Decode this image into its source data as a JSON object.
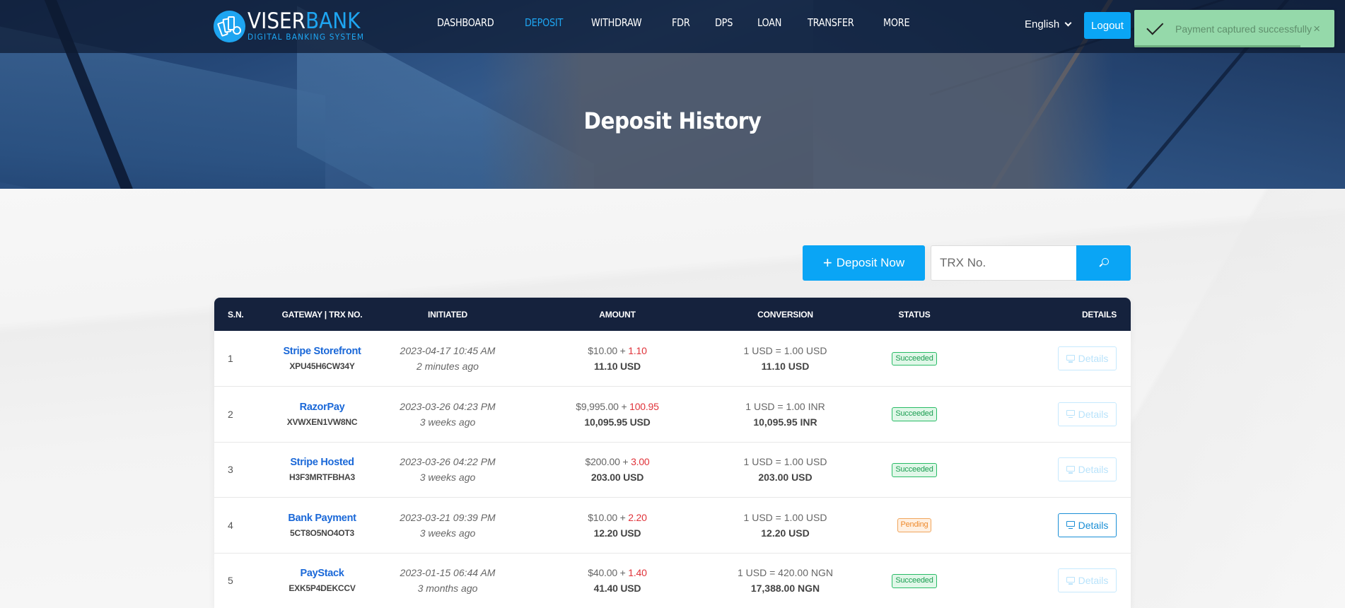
{
  "brand": {
    "name_primary": "VISER",
    "name_accent": "BANK",
    "tagline": "DIGITAL BANKING SYSTEM",
    "accent_color": "#1ea5f1"
  },
  "nav": {
    "items": [
      {
        "label": "DASHBOARD",
        "active": false
      },
      {
        "label": "DEPOSIT",
        "active": true
      },
      {
        "label": "WITHDRAW",
        "active": false
      },
      {
        "label": "FDR",
        "active": false
      },
      {
        "label": "DPS",
        "active": false
      },
      {
        "label": "LOAN",
        "active": false
      },
      {
        "label": "TRANSFER",
        "active": false
      },
      {
        "label": "MORE",
        "active": false
      }
    ],
    "language": "English",
    "logout_label": "Logout"
  },
  "toast": {
    "message": "Payment captured successfully",
    "icon": "check-icon",
    "close_symbol": "×",
    "progress_percent": 83,
    "color": "#95d9aa"
  },
  "hero": {
    "title": "Deposit History"
  },
  "toolbar": {
    "deposit_now_label": "Deposit Now",
    "deposit_now_icon": "+",
    "search_placeholder": "TRX No.",
    "search_value": ""
  },
  "table": {
    "headers": [
      "S.N.",
      "Gateway | TRX No.",
      "Initiated",
      "Amount",
      "Conversion",
      "Status",
      "Details"
    ],
    "rows": [
      {
        "sn": "1",
        "gateway": "Stripe Storefront",
        "trx": "XPU45H6CW34Y",
        "initiated_date": "2023-04-17 10:45 AM",
        "initiated_ago": "2 minutes ago",
        "amount": "$10.00",
        "amount_sep": " + ",
        "charge": "1.10",
        "amount_total": "11.10 USD",
        "conversion_rate": "1 USD = 1.00 USD",
        "conversion_total": "11.10 USD",
        "status": "Succeeded",
        "status_type": "success",
        "details_label": "Details",
        "details_enabled": false
      },
      {
        "sn": "2",
        "gateway": "RazorPay",
        "trx": "XVWXEN1VW8NC",
        "initiated_date": "2023-03-26 04:23 PM",
        "initiated_ago": "3 weeks ago",
        "amount": "$9,995.00",
        "amount_sep": " + ",
        "charge": "100.95",
        "amount_total": "10,095.95 USD",
        "conversion_rate": "1 USD = 1.00 INR",
        "conversion_total": "10,095.95 INR",
        "status": "Succeeded",
        "status_type": "success",
        "details_label": "Details",
        "details_enabled": false
      },
      {
        "sn": "3",
        "gateway": "Stripe Hosted",
        "trx": "H3F3MRTFBHA3",
        "initiated_date": "2023-03-26 04:22 PM",
        "initiated_ago": "3 weeks ago",
        "amount": "$200.00",
        "amount_sep": " + ",
        "charge": "3.00",
        "amount_total": "203.00 USD",
        "conversion_rate": "1 USD = 1.00 USD",
        "conversion_total": "203.00 USD",
        "status": "Succeeded",
        "status_type": "success",
        "details_label": "Details",
        "details_enabled": false
      },
      {
        "sn": "4",
        "gateway": "Bank Payment",
        "trx": "5CT8O5NO4OT3",
        "initiated_date": "2023-03-21 09:39 PM",
        "initiated_ago": "3 weeks ago",
        "amount": "$10.00",
        "amount_sep": " + ",
        "charge": "2.20",
        "amount_total": "12.20 USD",
        "conversion_rate": "1 USD = 1.00 USD",
        "conversion_total": "12.20 USD",
        "status": "Pending",
        "status_type": "pending",
        "details_label": "Details",
        "details_enabled": true
      },
      {
        "sn": "5",
        "gateway": "PayStack",
        "trx": "EXK5P4DEKCCV",
        "initiated_date": "2023-01-15 06:44 AM",
        "initiated_ago": "3 months ago",
        "amount": "$40.00",
        "amount_sep": " + ",
        "charge": "1.40",
        "amount_total": "41.40 USD",
        "conversion_rate": "1 USD = 420.00 NGN",
        "conversion_total": "17,388.00 NGN",
        "status": "Succeeded",
        "status_type": "success",
        "details_label": "Details",
        "details_enabled": false
      }
    ]
  }
}
